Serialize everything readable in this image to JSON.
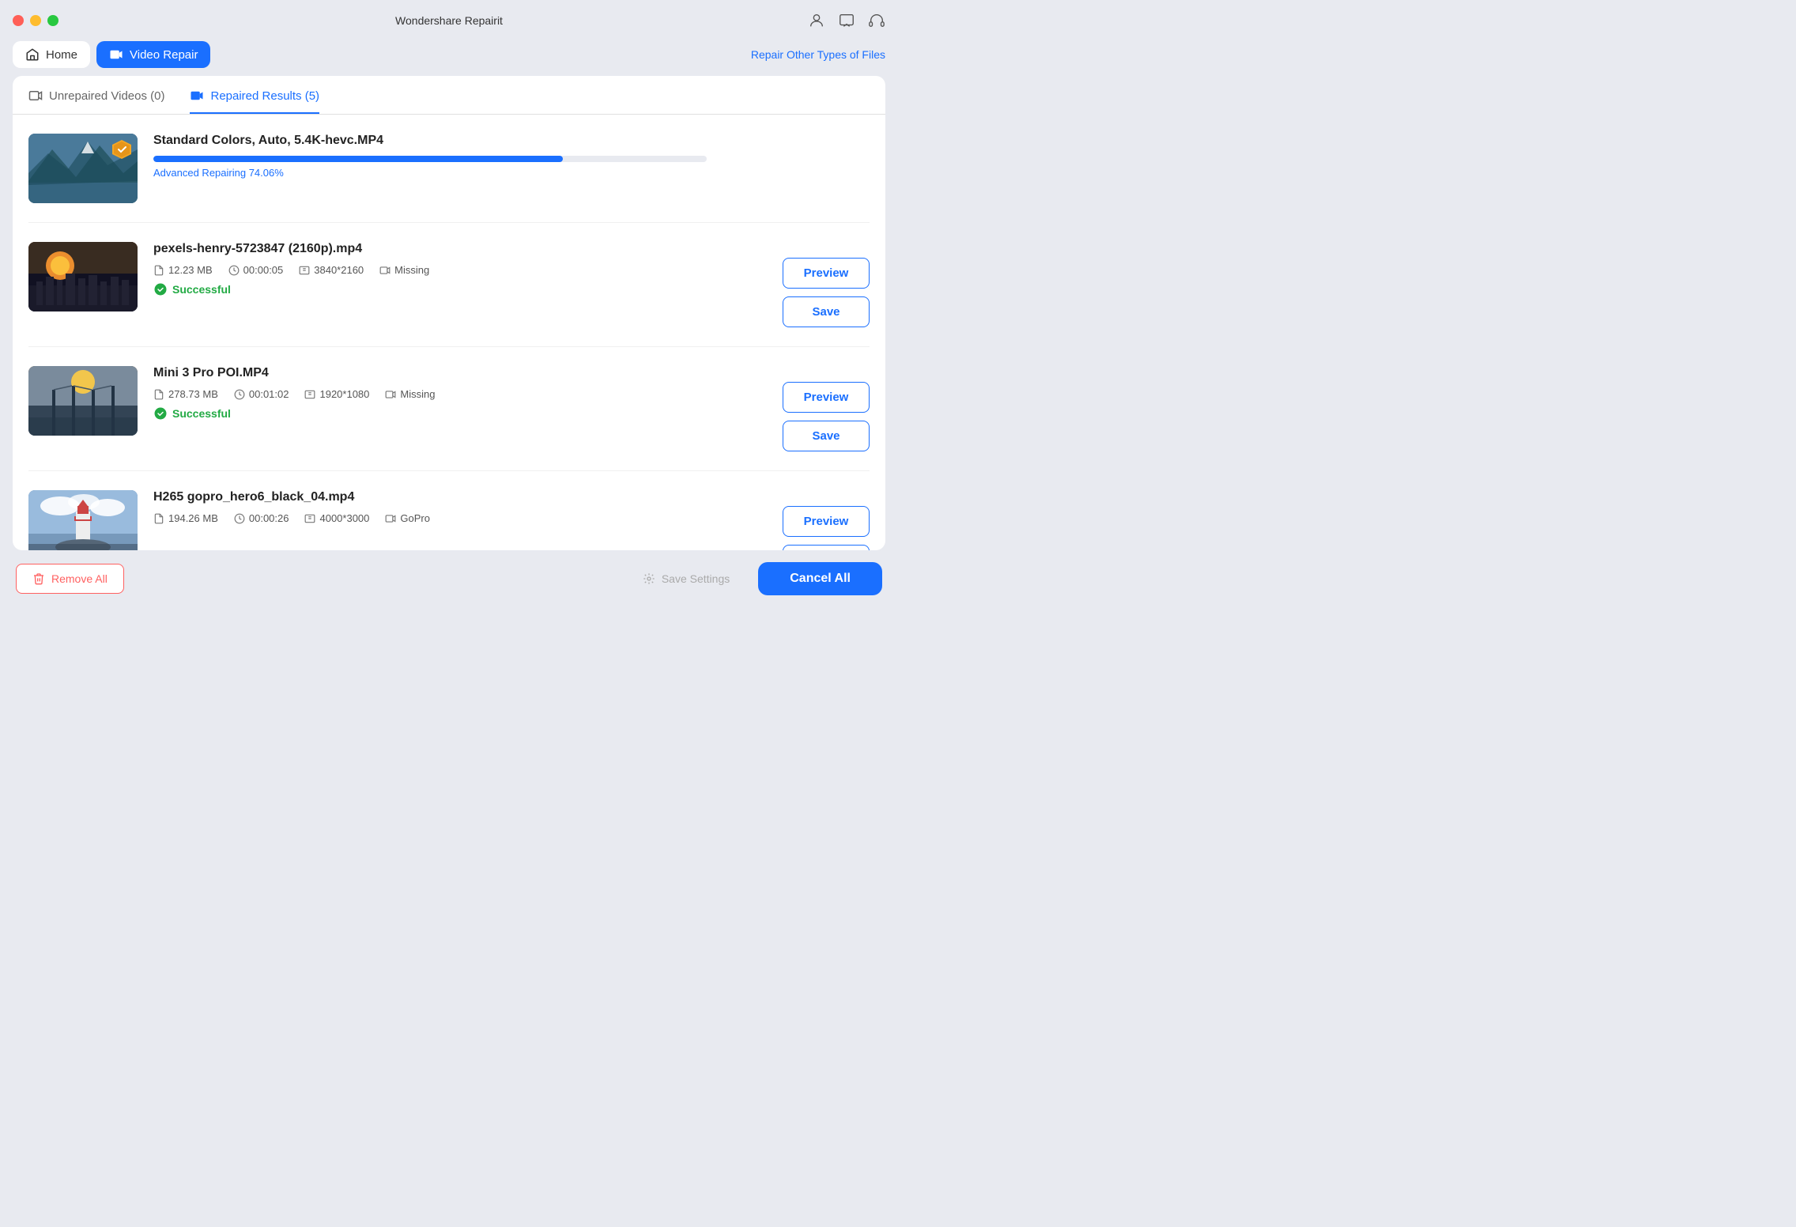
{
  "app": {
    "title": "Wondershare Repairit"
  },
  "nav": {
    "home_label": "Home",
    "video_repair_label": "Video Repair",
    "repair_other_label": "Repair Other Types of Files"
  },
  "tabs": {
    "unrepaired_label": "Unrepaired Videos (0)",
    "repaired_label": "Repaired Results (5)"
  },
  "videos": [
    {
      "id": 1,
      "name": "Standard Colors, Auto, 5.4K-hevc.MP4",
      "status": "repairing",
      "progress": 74.06,
      "progress_label": "Advanced Repairing 74.06%",
      "size": "",
      "duration": "",
      "resolution": "",
      "source": "",
      "thumb_class": "thumb-1",
      "show_badge": true
    },
    {
      "id": 2,
      "name": "pexels-henry-5723847 (2160p).mp4",
      "status": "success",
      "size": "12.23 MB",
      "duration": "00:00:05",
      "resolution": "3840*2160",
      "source": "Missing",
      "thumb_class": "thumb-2",
      "show_badge": false
    },
    {
      "id": 3,
      "name": "Mini 3 Pro POI.MP4",
      "status": "success",
      "size": "278.73 MB",
      "duration": "00:01:02",
      "resolution": "1920*1080",
      "source": "Missing",
      "thumb_class": "thumb-3",
      "show_badge": false
    },
    {
      "id": 4,
      "name": "H265 gopro_hero6_black_04.mp4",
      "status": "success",
      "size": "194.26 MB",
      "duration": "00:00:26",
      "resolution": "4000*3000",
      "source": "GoPro",
      "thumb_class": "thumb-4",
      "show_badge": false,
      "partial": true
    }
  ],
  "bottom": {
    "remove_all_label": "Remove All",
    "save_settings_label": "Save Settings",
    "cancel_all_label": "Cancel All"
  },
  "status_labels": {
    "successful": "Successful"
  },
  "button_labels": {
    "preview": "Preview",
    "save": "Save"
  }
}
